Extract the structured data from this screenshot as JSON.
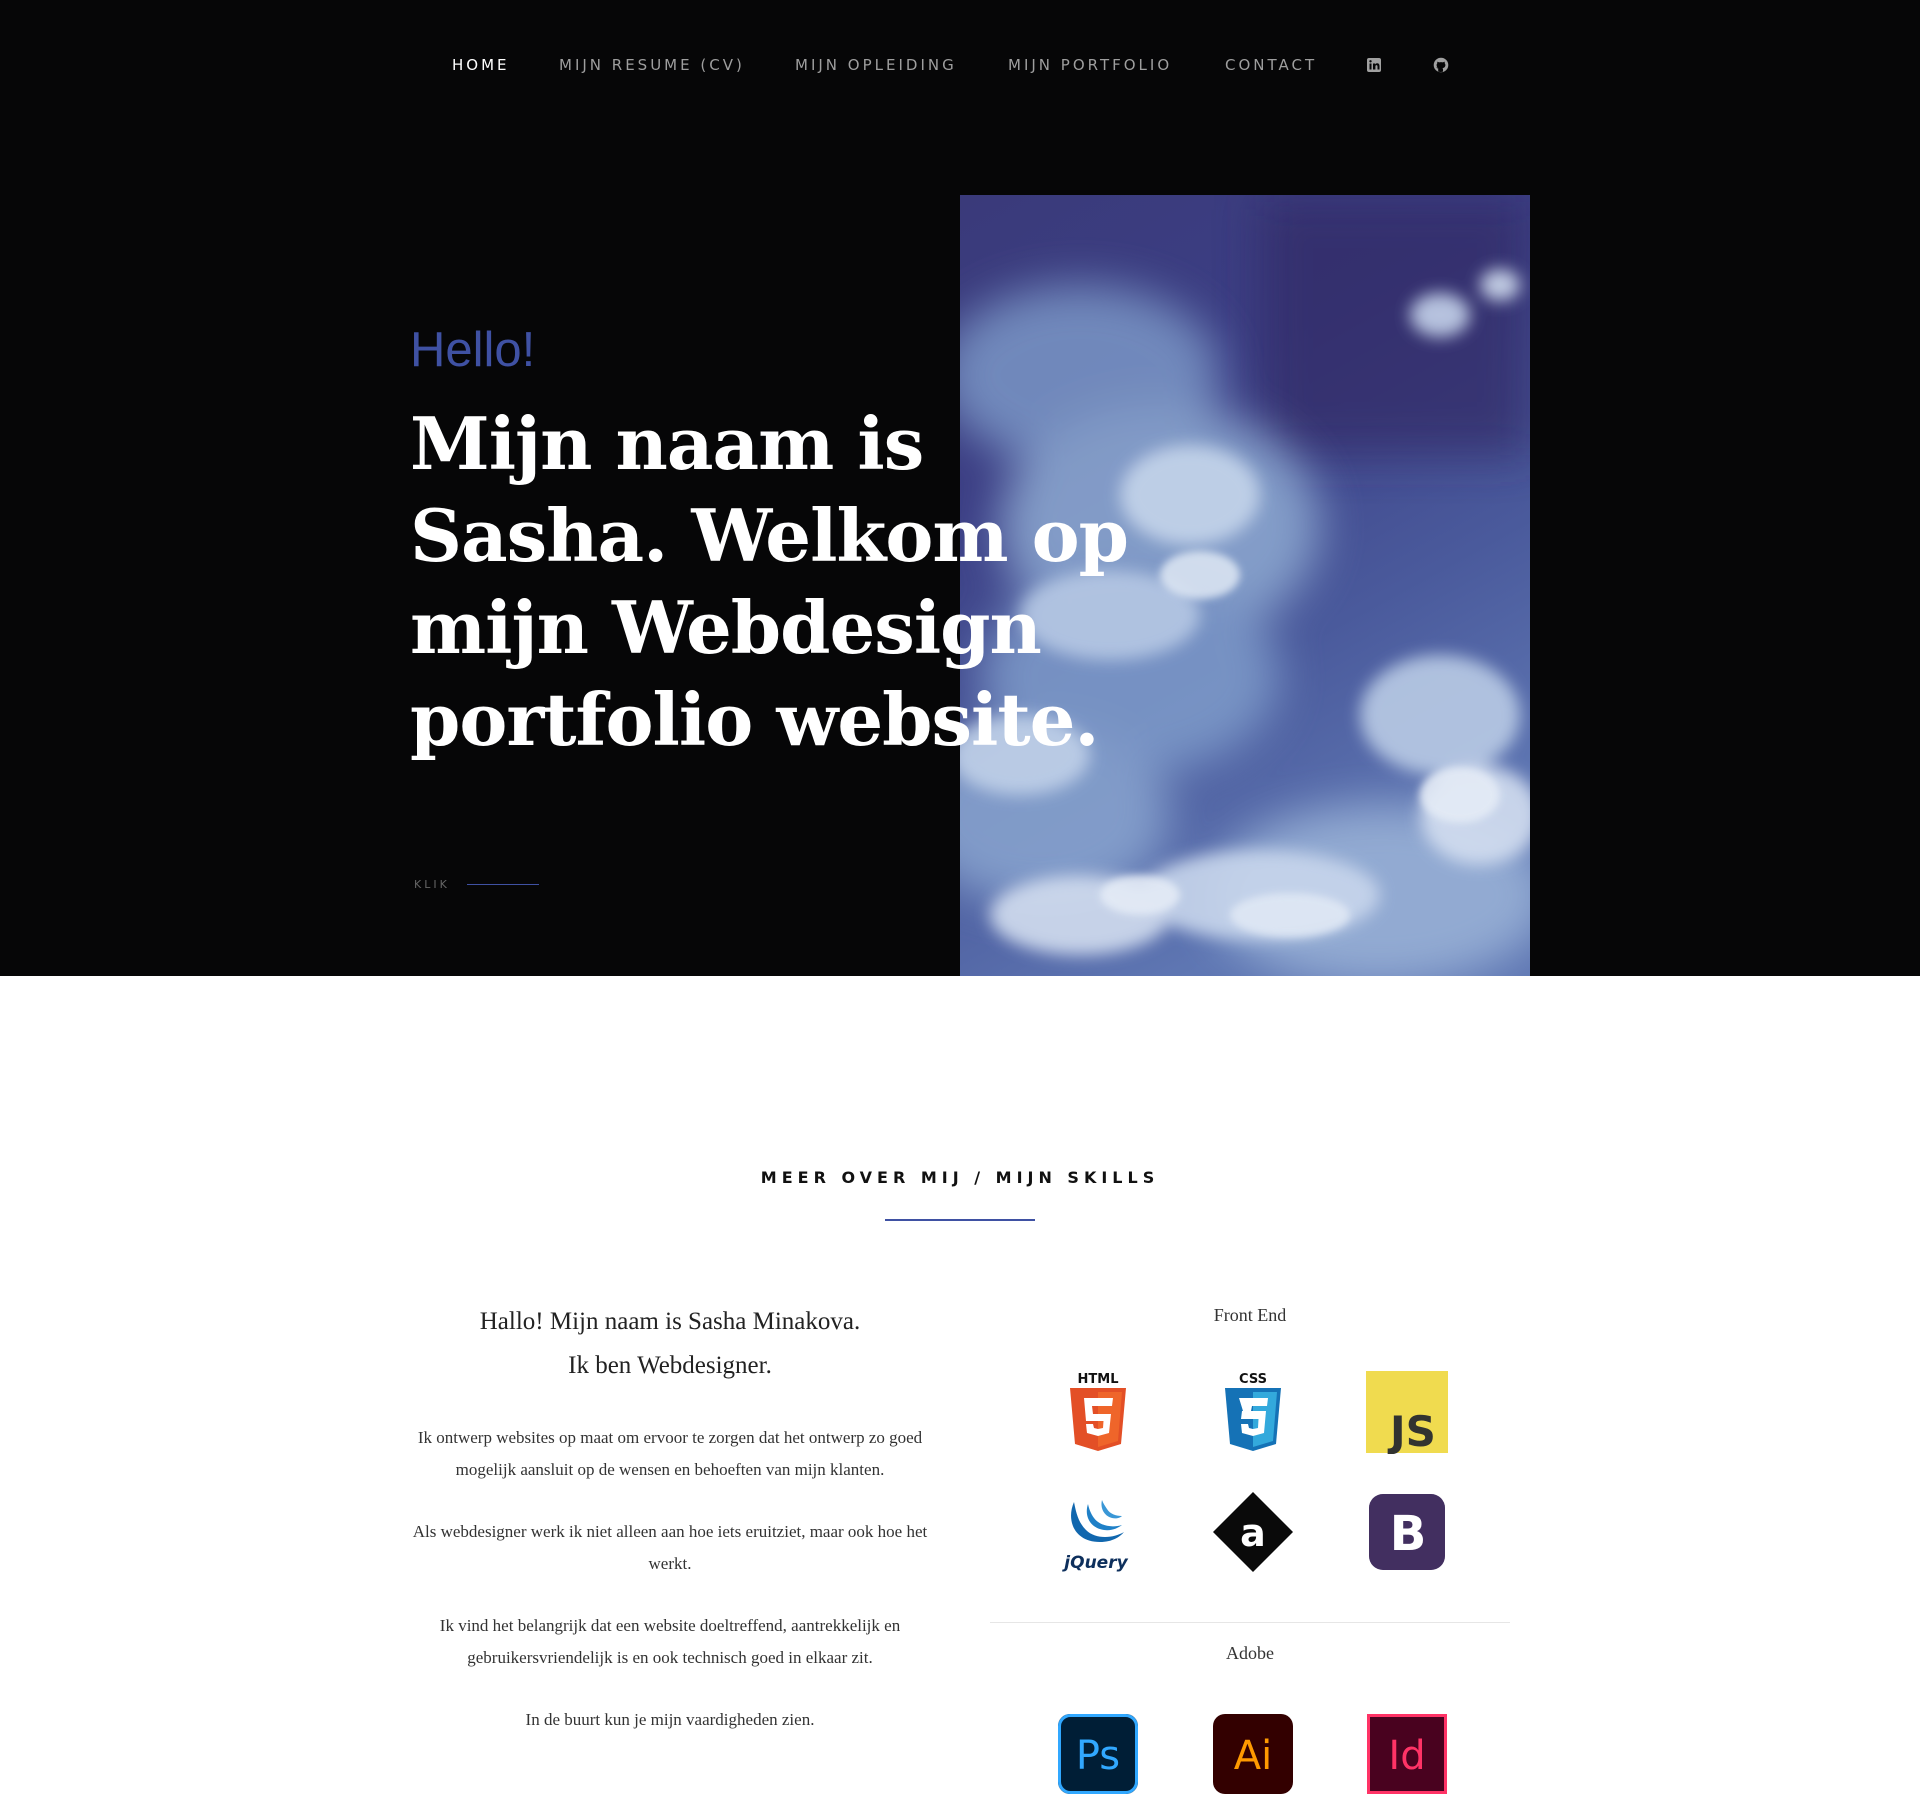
{
  "nav": {
    "items": [
      {
        "label": "HOME",
        "active": true
      },
      {
        "label": "MIJN RESUME (CV)",
        "active": false
      },
      {
        "label": "MIJN OPLEIDING",
        "active": false
      },
      {
        "label": "MIJN PORTFOLIO",
        "active": false
      },
      {
        "label": "CONTACT",
        "active": false
      }
    ],
    "icons": [
      "linkedin-icon",
      "github-icon"
    ]
  },
  "hero": {
    "greeting": "Hello!",
    "headline": "Mijn naam is Sasha. Welkom op mijn Webdesign portfolio website.",
    "scroll_label": "KLIK",
    "accent_color": "#3f51a3"
  },
  "about": {
    "section_title": "MEER OVER MIJ / MIJN SKILLS",
    "lead_line1": "Hallo! Mijn naam is Sasha Minakova.",
    "lead_line2": "Ik ben Webdesigner.",
    "paragraphs": [
      "Ik ontwerp websites op maat om ervoor te zorgen dat het ontwerp zo goed mogelijk aansluit op de wensen en behoeften van mijn klanten.",
      "Als webdesigner werk ik niet alleen aan hoe iets eruitziet, maar ook hoe het werkt.",
      "Ik vind het belangrijk dat een website doeltreffend, aantrekkelijk en gebruikersvriendelijk is en ook technisch goed in elkaar zit.",
      "In de buurt kun je mijn vaardigheden zien."
    ]
  },
  "skills": {
    "front_end": {
      "title": "Front End",
      "logos": [
        {
          "name": "html5-logo",
          "label": "HTML"
        },
        {
          "name": "css3-logo",
          "label": "CSS"
        },
        {
          "name": "javascript-logo",
          "label": "JS"
        },
        {
          "name": "jquery-logo",
          "label": "jQuery"
        },
        {
          "name": "angular-logo",
          "label": "a"
        },
        {
          "name": "bootstrap-logo",
          "label": "B"
        }
      ]
    },
    "adobe": {
      "title": "Adobe",
      "logos": [
        {
          "name": "photoshop-logo",
          "label": "Ps"
        },
        {
          "name": "illustrator-logo",
          "label": "Ai"
        },
        {
          "name": "indesign-logo",
          "label": "Id"
        }
      ]
    }
  }
}
